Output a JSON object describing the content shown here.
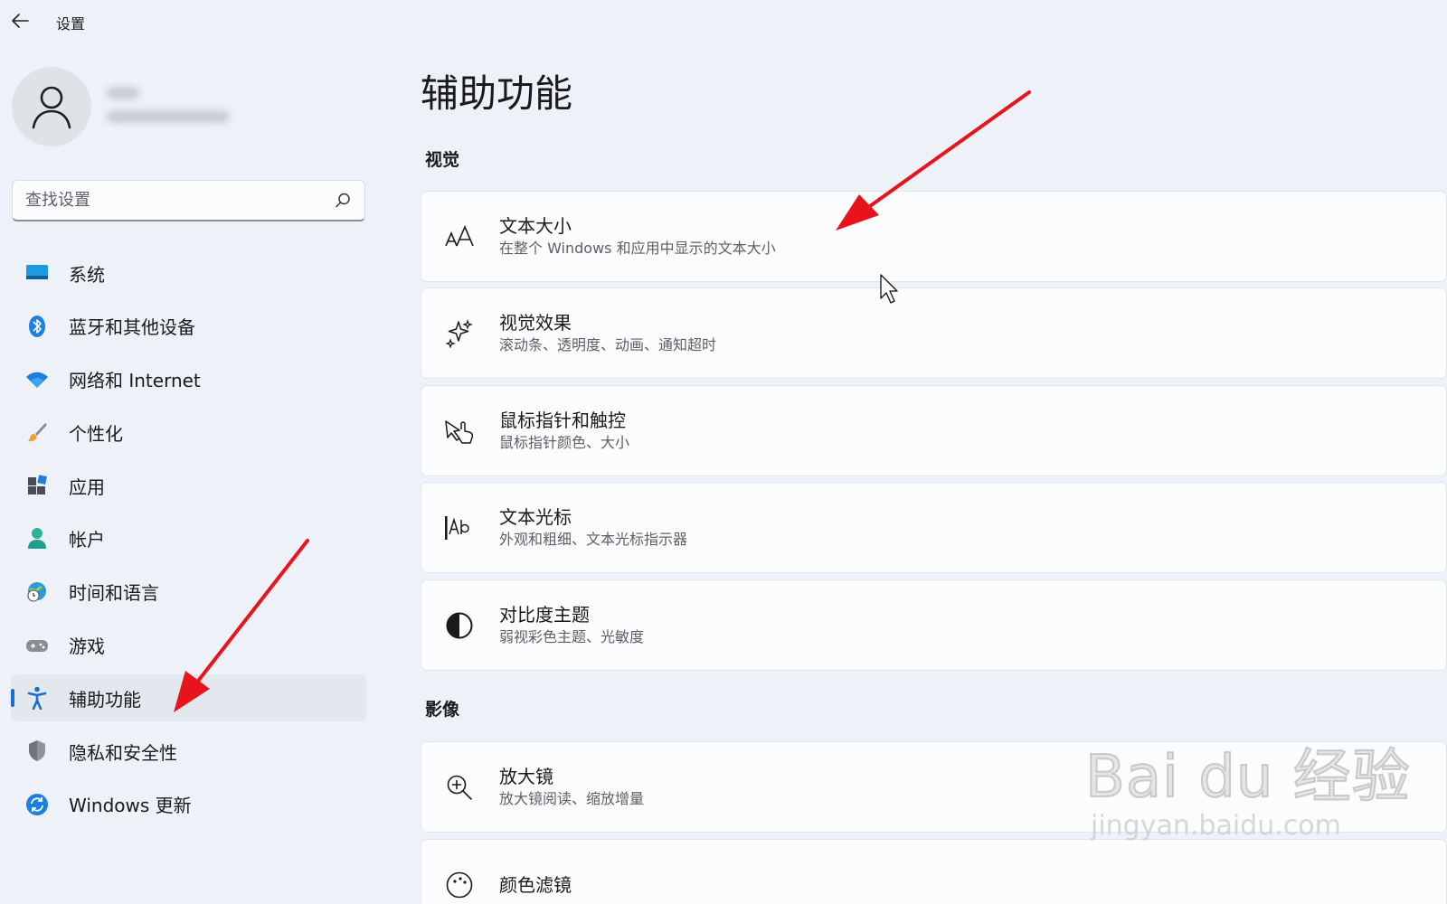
{
  "app": {
    "title": "设置"
  },
  "search": {
    "placeholder": "查找设置"
  },
  "sidebar": {
    "items": [
      {
        "label": "系统",
        "icon": "system-icon"
      },
      {
        "label": "蓝牙和其他设备",
        "icon": "bluetooth-icon"
      },
      {
        "label": "网络和 Internet",
        "icon": "wifi-icon"
      },
      {
        "label": "个性化",
        "icon": "brush-icon"
      },
      {
        "label": "应用",
        "icon": "apps-icon"
      },
      {
        "label": "帐户",
        "icon": "account-icon"
      },
      {
        "label": "时间和语言",
        "icon": "globe-clock-icon"
      },
      {
        "label": "游戏",
        "icon": "gamepad-icon"
      },
      {
        "label": "辅助功能",
        "icon": "accessibility-icon",
        "active": true
      },
      {
        "label": "隐私和安全性",
        "icon": "shield-icon"
      },
      {
        "label": "Windows 更新",
        "icon": "update-icon"
      }
    ]
  },
  "main": {
    "title": "辅助功能",
    "sections": [
      {
        "title": "视觉",
        "cards": [
          {
            "title": "文本大小",
            "desc": "在整个 Windows 和应用中显示的文本大小",
            "icon": "text-size-icon"
          },
          {
            "title": "视觉效果",
            "desc": "滚动条、透明度、动画、通知超时",
            "icon": "sparkle-icon"
          },
          {
            "title": "鼠标指针和触控",
            "desc": "鼠标指针颜色、大小",
            "icon": "pointer-touch-icon"
          },
          {
            "title": "文本光标",
            "desc": "外观和粗细、文本光标指示器",
            "icon": "text-cursor-icon"
          },
          {
            "title": "对比度主题",
            "desc": "弱视彩色主题、光敏度",
            "icon": "contrast-icon"
          }
        ]
      },
      {
        "title": "影像",
        "cards": [
          {
            "title": "放大镜",
            "desc": "放大镜阅读、缩放增量",
            "icon": "magnifier-icon"
          },
          {
            "title": "颜色滤镜",
            "desc": "",
            "icon": "color-filter-icon"
          }
        ]
      }
    ]
  },
  "watermark": {
    "logo": "Bai du 经验",
    "url": "jingyan.baidu.com"
  },
  "colors": {
    "accent": "#1a6ed0",
    "annotation_arrow": "#e8141b"
  }
}
